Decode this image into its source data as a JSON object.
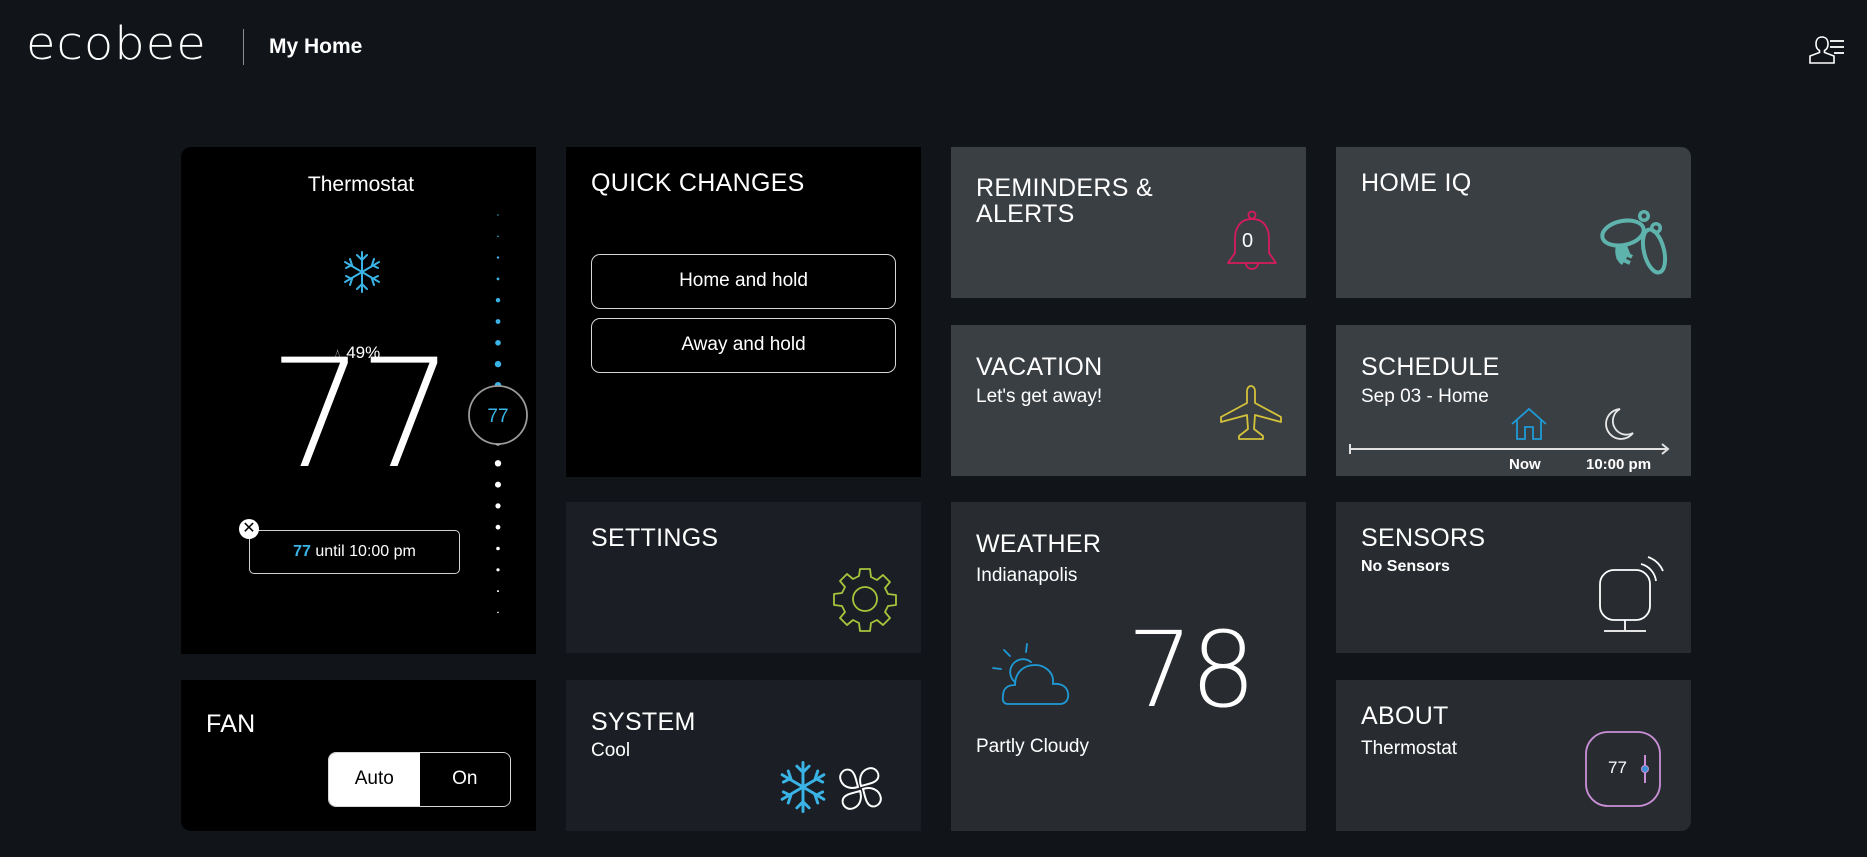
{
  "header": {
    "logo": "ecobee",
    "title": "My Home",
    "user_menu_icon": "user-menu-icon"
  },
  "colors": {
    "accent_blue": "#3ab4e6",
    "alert_pink": "#d81b5c",
    "bee_teal": "#5fb3ad",
    "plane_yellow": "#d4c23a",
    "gear_green": "#a7c43b",
    "about_purple": "#c98fd6"
  },
  "thermostat": {
    "title": "Thermostat",
    "mode_icon": "snowflake-icon",
    "humidity": "49%",
    "current_temp": "77",
    "setpoint": "77",
    "hold": {
      "temp": "77",
      "text": "until 10:00 pm",
      "close_icon": "close-icon"
    }
  },
  "quick_changes": {
    "title": "QUICK CHANGES",
    "buttons": [
      "Home and hold",
      "Away and hold"
    ]
  },
  "fan": {
    "title": "FAN",
    "options": [
      "Auto",
      "On"
    ],
    "selected": "Auto"
  },
  "settings": {
    "title": "SETTINGS",
    "icon": "gear-icon"
  },
  "system": {
    "title": "SYSTEM",
    "mode": "Cool",
    "icons": [
      "snowflake-icon",
      "fan-icon"
    ]
  },
  "reminders": {
    "title_line1": "REMINDERS &",
    "title_line2": "ALERTS",
    "count": "0",
    "icon": "bell-icon"
  },
  "vacation": {
    "title": "VACATION",
    "subtitle": "Let's get away!",
    "icon": "airplane-icon"
  },
  "weather": {
    "title": "WEATHER",
    "city": "Indianapolis",
    "temp": "78",
    "condition": "Partly Cloudy",
    "icon": "partly-cloudy-icon"
  },
  "home_iq": {
    "title": "HOME IQ",
    "icon": "bee-icon"
  },
  "schedule": {
    "title": "SCHEDULE",
    "subtitle": "Sep 03 - Home",
    "now_label": "Now",
    "next_label": "10:00 pm",
    "icons": [
      "home-icon",
      "moon-icon"
    ]
  },
  "sensors": {
    "title": "SENSORS",
    "subtitle": "No Sensors",
    "icon": "sensor-icon"
  },
  "about": {
    "title": "ABOUT",
    "subtitle": "Thermostat",
    "device_temp": "77",
    "icon": "thermostat-device-icon"
  }
}
